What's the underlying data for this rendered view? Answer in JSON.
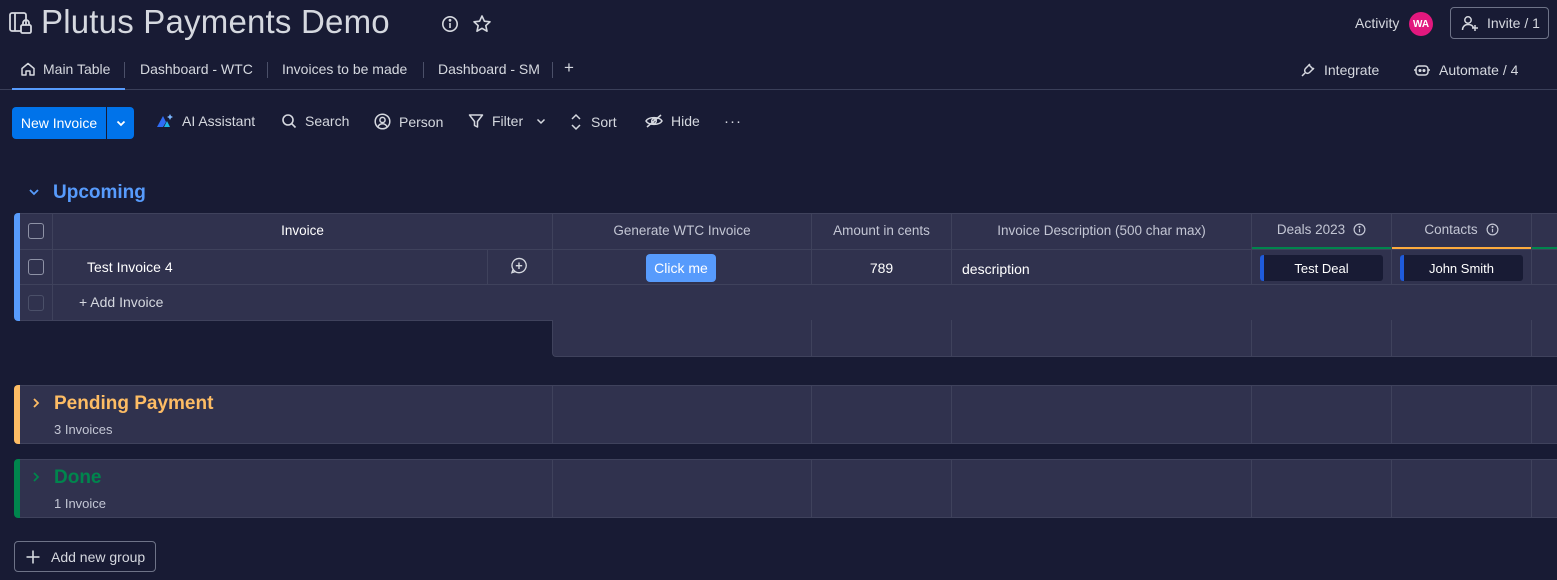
{
  "header": {
    "board_title": "Plutus Payments Demo",
    "activity_label": "Activity",
    "avatar_initials": "WA",
    "invite_label": "Invite / 1"
  },
  "tabs": [
    {
      "label": "Main Table",
      "active": true
    },
    {
      "label": "Dashboard - WTC"
    },
    {
      "label": "Invoices to be made"
    },
    {
      "label": "Dashboard - SM"
    }
  ],
  "tab_add": "+",
  "integrate_label": "Integrate",
  "automate_label": "Automate / 4",
  "toolbar": {
    "new_item": "New Invoice",
    "ai_assistant": "AI Assistant",
    "search": "Search",
    "person": "Person",
    "filter": "Filter",
    "sort": "Sort",
    "hide": "Hide",
    "more": "···"
  },
  "columns": {
    "item": "Invoice",
    "generate": "Generate WTC Invoice",
    "amount": "Amount in cents",
    "description": "Invoice Description (500 char max)",
    "deals": "Deals 2023",
    "contacts": "Contacts"
  },
  "groups": {
    "upcoming": {
      "title": "Upcoming",
      "color": "#579bfc",
      "rows": [
        {
          "name": "Test Invoice 4",
          "button": "Click me",
          "amount": "789",
          "description": "description",
          "deal": "Test Deal",
          "contact": "John Smith"
        }
      ],
      "add_label": "+ Add Invoice"
    },
    "pending": {
      "title": "Pending Payment",
      "color": "#fdbc64",
      "count": "3 Invoices"
    },
    "done": {
      "title": "Done",
      "color": "#00854d",
      "count": "1 Invoice"
    }
  },
  "add_group_label": "Add new group",
  "colors": {
    "background": "#181b34",
    "primary": "#0073ea",
    "click_button": "#579bfc",
    "deals_accent": "#00854d",
    "contacts_accent": "#fdab3d"
  }
}
